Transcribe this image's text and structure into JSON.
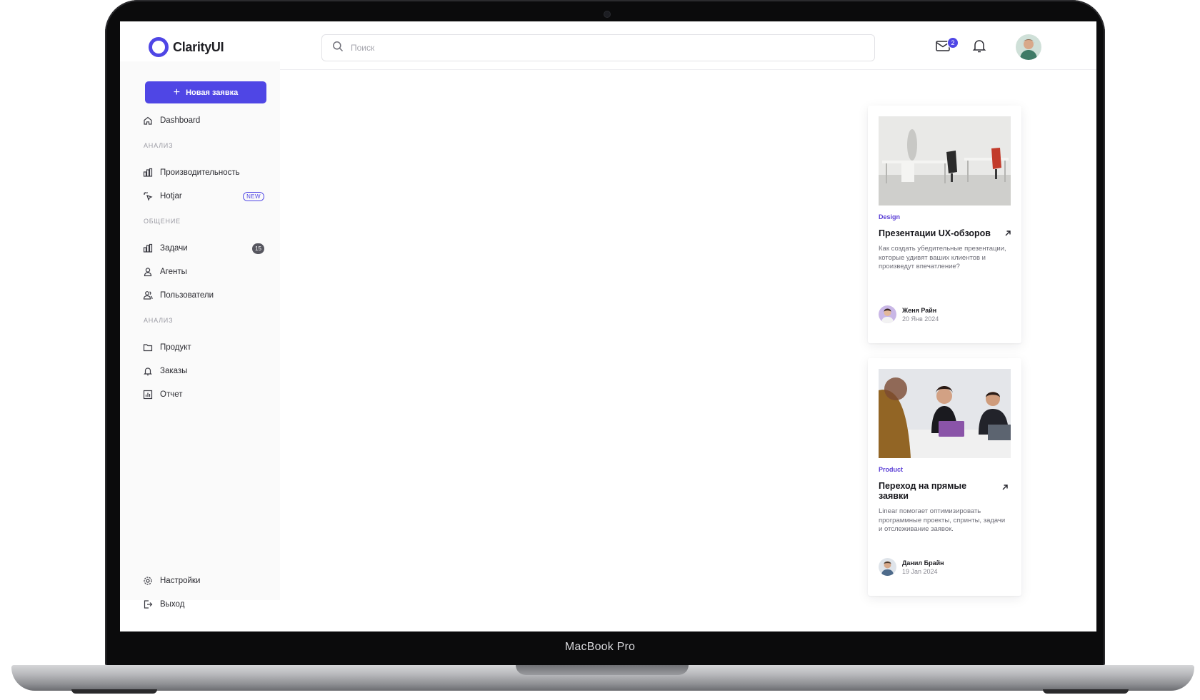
{
  "device": {
    "label": "MacBook Pro"
  },
  "app": {
    "name": "ClarityUI",
    "brand_color": "#4f46e5"
  },
  "search": {
    "placeholder": "Поиск",
    "value": ""
  },
  "header": {
    "mail_count": "2"
  },
  "sidebar": {
    "new_button": "Новая заявка",
    "dashboard": "Dashboard",
    "sections": [
      {
        "label": "Анализ",
        "items": [
          {
            "label": "Производительность",
            "icon": "bar-chart-icon"
          },
          {
            "label": "Hotjar",
            "icon": "pointer-click-icon",
            "badge": "NEW"
          }
        ]
      },
      {
        "label": "Общение",
        "items": [
          {
            "label": "Задачи",
            "icon": "bar-chart-icon",
            "badge": "15"
          },
          {
            "label": "Агенты",
            "icon": "user-icon"
          },
          {
            "label": "Пользователи",
            "icon": "users-icon"
          }
        ]
      },
      {
        "label": "Анализ",
        "items": [
          {
            "label": "Продукт",
            "icon": "folder-icon"
          },
          {
            "label": "Заказы",
            "icon": "bell-icon"
          },
          {
            "label": "Отчет",
            "icon": "report-icon"
          }
        ]
      }
    ],
    "footer": [
      {
        "label": "Настройки",
        "icon": "gear-icon"
      },
      {
        "label": "Выход",
        "icon": "logout-icon"
      }
    ]
  },
  "cards": [
    {
      "tag": "Design",
      "title": "Презентации UX-обзоров",
      "description": "Как создать убедительные презентации, которые удивят ваших клиентов и произведут впечатление?",
      "author": "Женя Райн",
      "date": "20 Янв 2024",
      "image": "office-photo"
    },
    {
      "tag": "Product",
      "title": "Переход на прямые заявки",
      "description": "Linear помогает оптимизировать программные проекты, спринты, задачи и отслеживание заявок.",
      "author": "Данил Брайн",
      "date": "19 Jan 2024",
      "image": "team-photo"
    }
  ]
}
